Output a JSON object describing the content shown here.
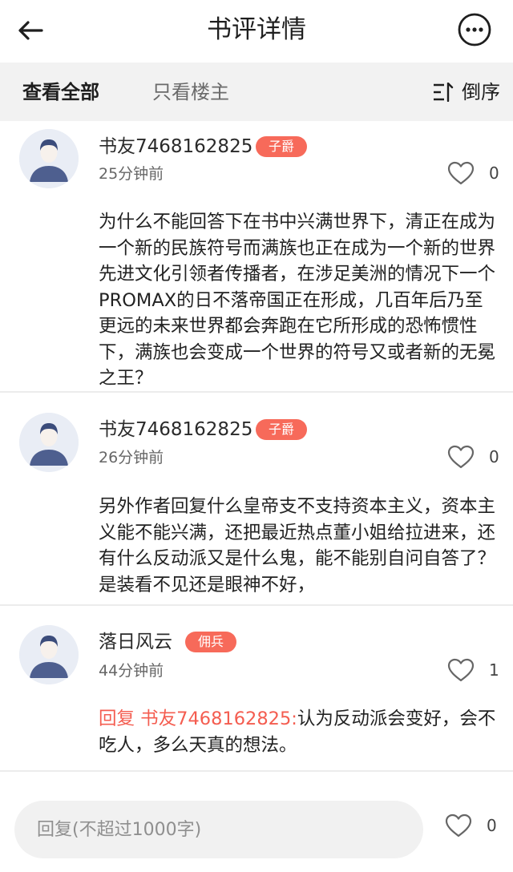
{
  "header": {
    "title": "书评详情",
    "back_icon": "arrow-left-icon",
    "more_icon": "more-dots-icon"
  },
  "filters": {
    "all_label": "查看全部",
    "owner_label": "只看楼主",
    "sort_label": "倒序",
    "sort_icon": "sort-order-icon"
  },
  "colors": {
    "accent": "#f76a5a",
    "reply_prefix": "#f45d50",
    "filter_bar_bg": "#f2f2f2"
  },
  "comments": [
    {
      "username": "书友7468162825",
      "badge": "子爵",
      "time": "25分钟前",
      "likes": "0",
      "text": "为什么不能回答下在书中兴满世界下，清正在成为一个新的民族符号而满族也正在成为一个新的世界先进文化引领者传播者，在涉足美洲的情况下一个PROMAX的日不落帝国正在形成，几百年后乃至更远的未来世界都会奔跑在它所形成的恐怖惯性下，满族也会变成一个世界的符号又或者新的无冕之王？"
    },
    {
      "username": "书友7468162825",
      "badge": "子爵",
      "time": "26分钟前",
      "likes": "0",
      "text": "另外作者回复什么皇帝支不支持资本主义，资本主义能不能兴满，还把最近热点董小姐给拉进来，还有什么反动派又是什么鬼，能不能别自问自答了？是装看不见还是眼神不好，"
    },
    {
      "username": "落日风云",
      "badge": "佣兵",
      "time": "44分钟前",
      "likes": "1",
      "reply_prefix": "回复 书友7468162825:",
      "text": "认为反动派会变好，会不吃人，多么天真的想法。"
    }
  ],
  "footer": {
    "reply_placeholder": "回复(不超过1000字)",
    "likes": "0"
  }
}
